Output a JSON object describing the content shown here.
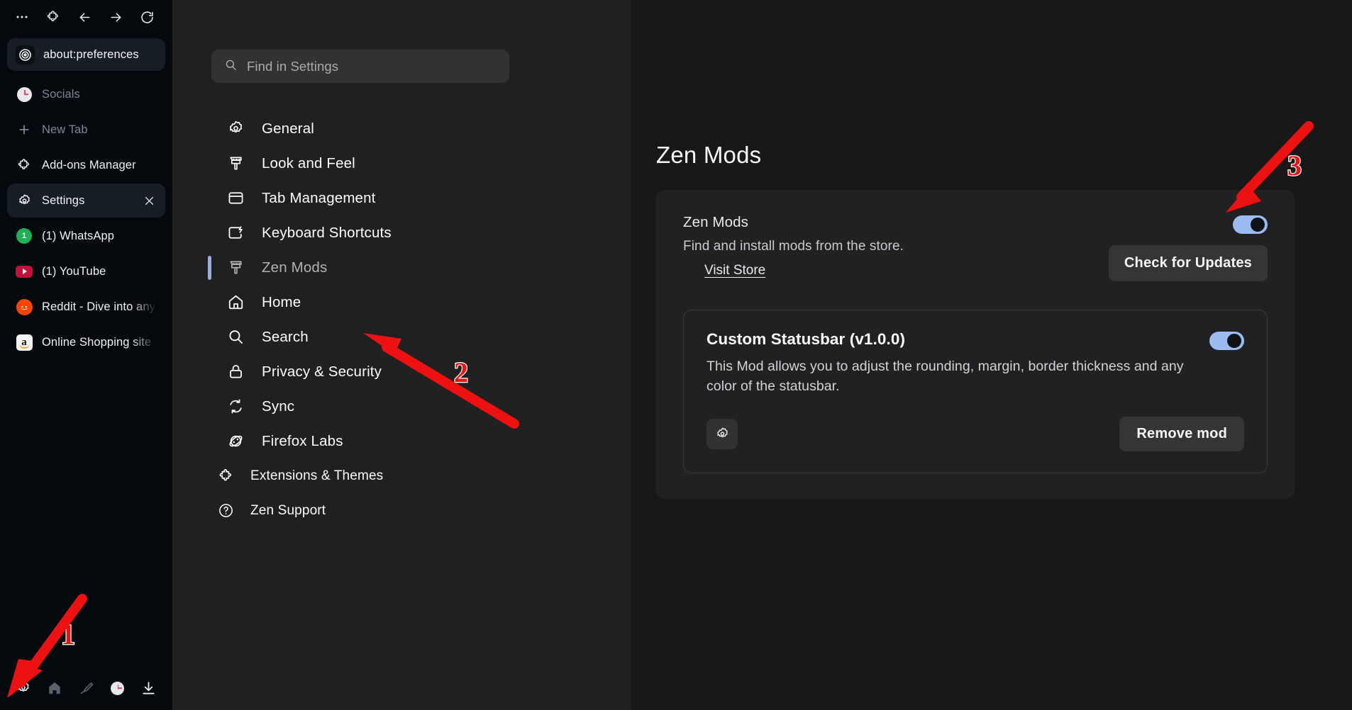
{
  "browser": {
    "toolbar": [
      {
        "name": "more-options",
        "icon": "ellipsis"
      },
      {
        "name": "extensions",
        "icon": "puzzle"
      },
      {
        "name": "back",
        "icon": "arrow-left"
      },
      {
        "name": "forward",
        "icon": "arrow-right"
      },
      {
        "name": "reload",
        "icon": "reload"
      }
    ],
    "url_bar": {
      "value": "about:preferences",
      "favicon": "zen-logo"
    },
    "tabs": [
      {
        "label": "Socials",
        "favicon": "clock",
        "state": "dim",
        "closable": false
      },
      {
        "label": "New Tab",
        "favicon": "plus",
        "state": "dim",
        "closable": false
      },
      {
        "label": "Add-ons Manager",
        "favicon": "puzzle",
        "state": "normal",
        "closable": false
      },
      {
        "label": "Settings",
        "favicon": "gear",
        "state": "active",
        "closable": true
      },
      {
        "label": "(1) WhatsApp",
        "favicon": "whatsapp",
        "state": "normal",
        "closable": false
      },
      {
        "label": "(1) YouTube",
        "favicon": "youtube",
        "state": "normal",
        "closable": false
      },
      {
        "label": "Reddit - Dive into any",
        "favicon": "reddit",
        "state": "normal",
        "closable": false
      },
      {
        "label": "Online Shopping site",
        "favicon": "amazon",
        "state": "normal",
        "closable": false
      }
    ],
    "bottom_bar": [
      {
        "name": "settings",
        "icon": "gear"
      },
      {
        "name": "home",
        "icon": "home"
      },
      {
        "name": "pick-color",
        "icon": "eyedropper"
      },
      {
        "name": "history",
        "icon": "clock"
      },
      {
        "name": "downloads",
        "icon": "download"
      }
    ]
  },
  "settings": {
    "search": {
      "placeholder": "Find in Settings",
      "value": ""
    },
    "nav_items": [
      {
        "label": "General",
        "icon": "gear-icon",
        "selected": false,
        "sub": false
      },
      {
        "label": "Look and Feel",
        "icon": "paintbrush-icon",
        "selected": false,
        "sub": false
      },
      {
        "label": "Tab Management",
        "icon": "window-icon",
        "selected": false,
        "sub": false
      },
      {
        "label": "Keyboard Shortcuts",
        "icon": "keyboard-icon",
        "selected": false,
        "sub": false
      },
      {
        "label": "Zen Mods",
        "icon": "paintbrush-icon",
        "selected": true,
        "sub": false
      },
      {
        "label": "Home",
        "icon": "home-icon",
        "selected": false,
        "sub": false
      },
      {
        "label": "Search",
        "icon": "search-icon",
        "selected": false,
        "sub": false
      },
      {
        "label": "Privacy & Security",
        "icon": "lock-icon",
        "selected": false,
        "sub": false
      },
      {
        "label": "Sync",
        "icon": "sync-icon",
        "selected": false,
        "sub": false
      },
      {
        "label": "Firefox Labs",
        "icon": "atom-icon",
        "selected": false,
        "sub": false
      },
      {
        "label": "Extensions & Themes",
        "icon": "puzzle-icon",
        "selected": false,
        "sub": true
      },
      {
        "label": "Zen Support",
        "icon": "help-icon",
        "selected": false,
        "sub": true
      }
    ]
  },
  "content": {
    "page_title": "Zen Mods",
    "zen_mods_group": {
      "title": "Zen Mods",
      "description": "Find and install mods from the store.",
      "store_link": "Visit Store",
      "enabled": true,
      "update_button": "Check for Updates"
    },
    "installed_mods": [
      {
        "title": "Custom Statusbar (v1.0.0)",
        "description": "This Mod allows you to adjust the rounding, margin, border thickness and any color of the statusbar.",
        "enabled": true,
        "settings_button": "gear-icon",
        "remove_button": "Remove mod"
      }
    ]
  },
  "annotations": {
    "accent_color": "#ee1111",
    "markers": [
      {
        "number": "1",
        "target": "bottom-bar-settings-icon"
      },
      {
        "number": "2",
        "target": "nav-item-zen-mods"
      },
      {
        "number": "3",
        "target": "zen-mods-page-header"
      }
    ]
  },
  "colors": {
    "toggle_on": "#9bbcf0",
    "selection_indicator": "#9aaddd",
    "panel_background": "#212124",
    "content_background": "#18181a",
    "nav_background": "#202021",
    "browser_sidebar": "#04090e"
  }
}
